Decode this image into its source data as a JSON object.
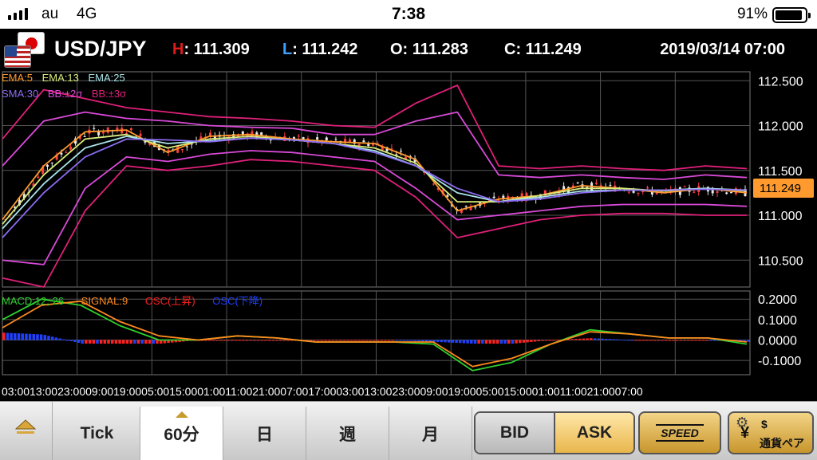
{
  "status_bar": {
    "carrier": "au",
    "network": "4G",
    "time": "7:38",
    "battery_percent": "91%",
    "battery_level": 0.91
  },
  "header": {
    "pair": "USD/JPY",
    "high_label": "H",
    "high_value": ": 111.309",
    "low_label": "L",
    "low_value": ": 111.242",
    "open_text": "O: 111.283",
    "close_text": "C: 111.249",
    "datetime": "2019/03/14 07:00",
    "icons": [
      "usd-flag-icon",
      "jpy-flag-icon"
    ]
  },
  "legend": {
    "ema5": "EMA:5",
    "ema13": "EMA:13",
    "ema25": "EMA:25",
    "sma30": "SMA:30",
    "bb2": "BB:±2σ",
    "bb3": "BB:±3σ",
    "macd": "MACD:12, 26",
    "signal": "SIGNAL:9",
    "osc_up": "OSC(上昇)",
    "osc_down": "OSC(下降)"
  },
  "colors": {
    "ema5": "#ff9a2e",
    "ema13": "#d8ec7a",
    "ema25": "#a9e3e8",
    "sma30": "#8b6cf0",
    "bb2": "#d94ad8",
    "bb3": "#e0207a",
    "macd": "#2ed12e",
    "signal": "#ff8a1e",
    "osc_up": "#ff2020",
    "osc_down": "#2040ff",
    "candle_up": "#ff4040",
    "candle_down": "#e8e8e8",
    "current_price_bg": "#ff9a2e"
  },
  "chart_data": [
    {
      "type": "line",
      "title": "",
      "current_price": "111.249",
      "y_ticks": [
        "112.500",
        "112.000",
        "111.500",
        "111.000",
        "110.500"
      ],
      "ylim": [
        110.2,
        112.6
      ],
      "x_tick_text": "03:0013:0023:0009:0019:0005:0015:0001:0011:0021:0007:0017:0003:0013:0023:0009:0019:0005:0015:0001:0011:0021:0007:00",
      "series": [
        {
          "name": "EMA:5",
          "values": [
            110.95,
            111.55,
            111.93,
            111.95,
            111.7,
            111.88,
            111.9,
            111.85,
            111.82,
            111.8,
            111.62,
            111.05,
            111.18,
            111.22,
            111.33,
            111.3,
            111.25,
            111.3,
            111.25
          ]
        },
        {
          "name": "EMA:13",
          "values": [
            110.9,
            111.45,
            111.85,
            111.9,
            111.75,
            111.85,
            111.88,
            111.84,
            111.8,
            111.75,
            111.58,
            111.15,
            111.15,
            111.22,
            111.3,
            111.3,
            111.27,
            111.3,
            111.27
          ]
        },
        {
          "name": "EMA:25",
          "values": [
            110.85,
            111.35,
            111.75,
            111.88,
            111.8,
            111.83,
            111.86,
            111.84,
            111.8,
            111.72,
            111.55,
            111.25,
            111.15,
            111.2,
            111.27,
            111.28,
            111.28,
            111.3,
            111.28
          ]
        },
        {
          "name": "SMA:30",
          "values": [
            110.75,
            111.25,
            111.65,
            111.85,
            111.84,
            111.82,
            111.86,
            111.84,
            111.8,
            111.7,
            111.55,
            111.3,
            111.15,
            111.18,
            111.25,
            111.28,
            111.28,
            111.29,
            111.28
          ]
        },
        {
          "name": "BB:+2σ",
          "values": [
            111.55,
            112.05,
            112.15,
            112.08,
            112.05,
            112.0,
            111.98,
            111.97,
            111.9,
            111.9,
            112.05,
            112.15,
            111.45,
            111.42,
            111.45,
            111.42,
            111.4,
            111.45,
            111.42
          ]
        },
        {
          "name": "BB:-2σ",
          "values": [
            110.5,
            110.45,
            111.3,
            111.65,
            111.6,
            111.68,
            111.72,
            111.7,
            111.65,
            111.6,
            111.3,
            110.95,
            111.0,
            111.05,
            111.1,
            111.12,
            111.12,
            111.12,
            111.1
          ]
        },
        {
          "name": "BB:+3σ",
          "values": [
            111.85,
            112.4,
            112.3,
            112.2,
            112.15,
            112.1,
            112.08,
            112.05,
            112.0,
            111.98,
            112.25,
            112.45,
            111.55,
            111.52,
            111.55,
            111.52,
            111.5,
            111.55,
            111.52
          ]
        },
        {
          "name": "BB:-3σ",
          "values": [
            110.3,
            110.2,
            111.05,
            111.55,
            111.5,
            111.55,
            111.62,
            111.6,
            111.55,
            111.5,
            111.2,
            110.75,
            110.85,
            110.95,
            111.0,
            111.02,
            111.02,
            111.0,
            111.0
          ]
        }
      ]
    },
    {
      "type": "line",
      "title": "",
      "y_ticks": [
        "0.2000",
        "0.1000",
        "0.0000",
        "-0.1000"
      ],
      "ylim": [
        -0.17,
        0.24
      ],
      "series": [
        {
          "name": "MACD:12, 26",
          "values": [
            0.1,
            0.2,
            0.17,
            0.07,
            0.0,
            0.0,
            0.02,
            0.01,
            -0.01,
            -0.01,
            -0.01,
            -0.02,
            -0.15,
            -0.11,
            -0.02,
            0.05,
            0.03,
            0.01,
            0.01,
            -0.02
          ]
        },
        {
          "name": "SIGNAL:9",
          "values": [
            0.06,
            0.17,
            0.19,
            0.09,
            0.02,
            0.0,
            0.02,
            0.01,
            -0.01,
            -0.01,
            -0.01,
            -0.01,
            -0.13,
            -0.09,
            -0.02,
            0.04,
            0.03,
            0.01,
            0.01,
            -0.01
          ]
        }
      ]
    }
  ],
  "toolbar": {
    "tick": "Tick",
    "min60": "60分",
    "day": "日",
    "week": "週",
    "month": "月",
    "bid": "BID",
    "ask": "ASK",
    "speed": "SPEED",
    "currency_pair": "通貨ペア"
  }
}
